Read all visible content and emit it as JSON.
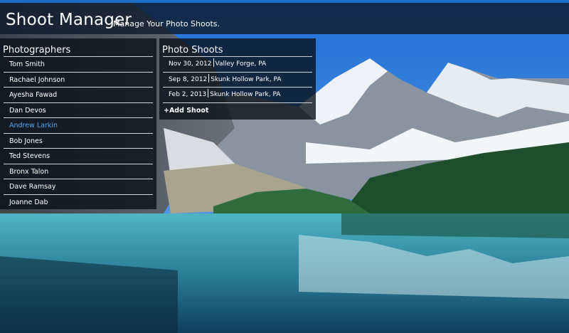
{
  "app": {
    "title": "Shoot Manager",
    "subtitle": "Manage Your Photo Shoots."
  },
  "photographers": {
    "header": "Photographers",
    "items": [
      {
        "name": "Tom Smith",
        "active": false
      },
      {
        "name": "Rachael Johnson",
        "active": false
      },
      {
        "name": "Ayesha Fawad",
        "active": false
      },
      {
        "name": "Dan Devos",
        "active": false
      },
      {
        "name": "Andrew Larkin",
        "active": true
      },
      {
        "name": "Bob Jones",
        "active": false
      },
      {
        "name": "Ted Stevens",
        "active": false
      },
      {
        "name": "Bronx Talon",
        "active": false
      },
      {
        "name": "Dave Ramsay",
        "active": false
      },
      {
        "name": "Joanne Dab",
        "active": false
      }
    ]
  },
  "shoots": {
    "header": "Photo Shoots",
    "items": [
      {
        "date": "Nov 30, 2012",
        "location": "Valley Forge, PA"
      },
      {
        "date": "Sep 8, 2012",
        "location": "Skunk Hollow Park, PA"
      },
      {
        "date": "Feb 2, 2013",
        "location": "Skunk Hollow Park, PA"
      }
    ],
    "add_label": "+Add Shoot"
  },
  "colors": {
    "accent_bar": "#1a6fc4",
    "active_item": "#4fa6f0"
  }
}
